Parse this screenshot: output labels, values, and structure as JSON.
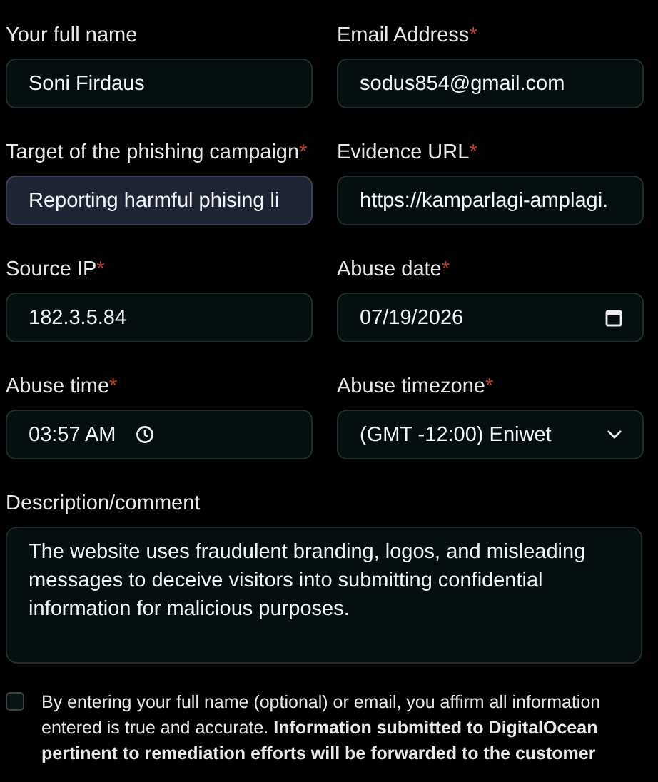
{
  "fields": [
    {
      "kind": "text",
      "label": "Your full name",
      "value": "Soni Firdaus",
      "focused": false
    },
    {
      "kind": "text",
      "label": "Email Address",
      "mark": "*",
      "value": "sodus854@gmail.com",
      "focused": false
    },
    {
      "kind": "text",
      "label": "Target of the phishing campaign",
      "mark": "*",
      "value": "Reporting harmful phising li",
      "focused": true
    },
    {
      "kind": "text",
      "label": "Evidence URL",
      "mark": "*",
      "value": "https://kamparlagi-amplagi.",
      "focused": false
    },
    {
      "kind": "text",
      "label": "Source IP",
      "mark": "*",
      "value": "182.3.5.84",
      "focused": false
    },
    {
      "kind": "date",
      "label": "Abuse date",
      "mark": "*",
      "value": "07/19/2026",
      "focused": false
    },
    {
      "kind": "time",
      "label": "Abuse time",
      "mark": "*",
      "value": "03:57  AM",
      "focused": false
    },
    {
      "kind": "select",
      "label": "Abuse timezone",
      "mark": "*",
      "value": "(GMT -12:00) Eniwet",
      "focused": false
    }
  ],
  "description": {
    "label": "Description/comment",
    "value": "The website uses fraudulent branding, logos, and misleading messages to deceive visitors into submitting confidential information for malicious purposes."
  },
  "consent": {
    "checked": false,
    "text": "By entering your full name (optional) or email, you affirm all information entered is true and accurate. **Information submitted to DigitalOcean pertinent to remediation efforts will be forwarded to the customer**"
  }
}
